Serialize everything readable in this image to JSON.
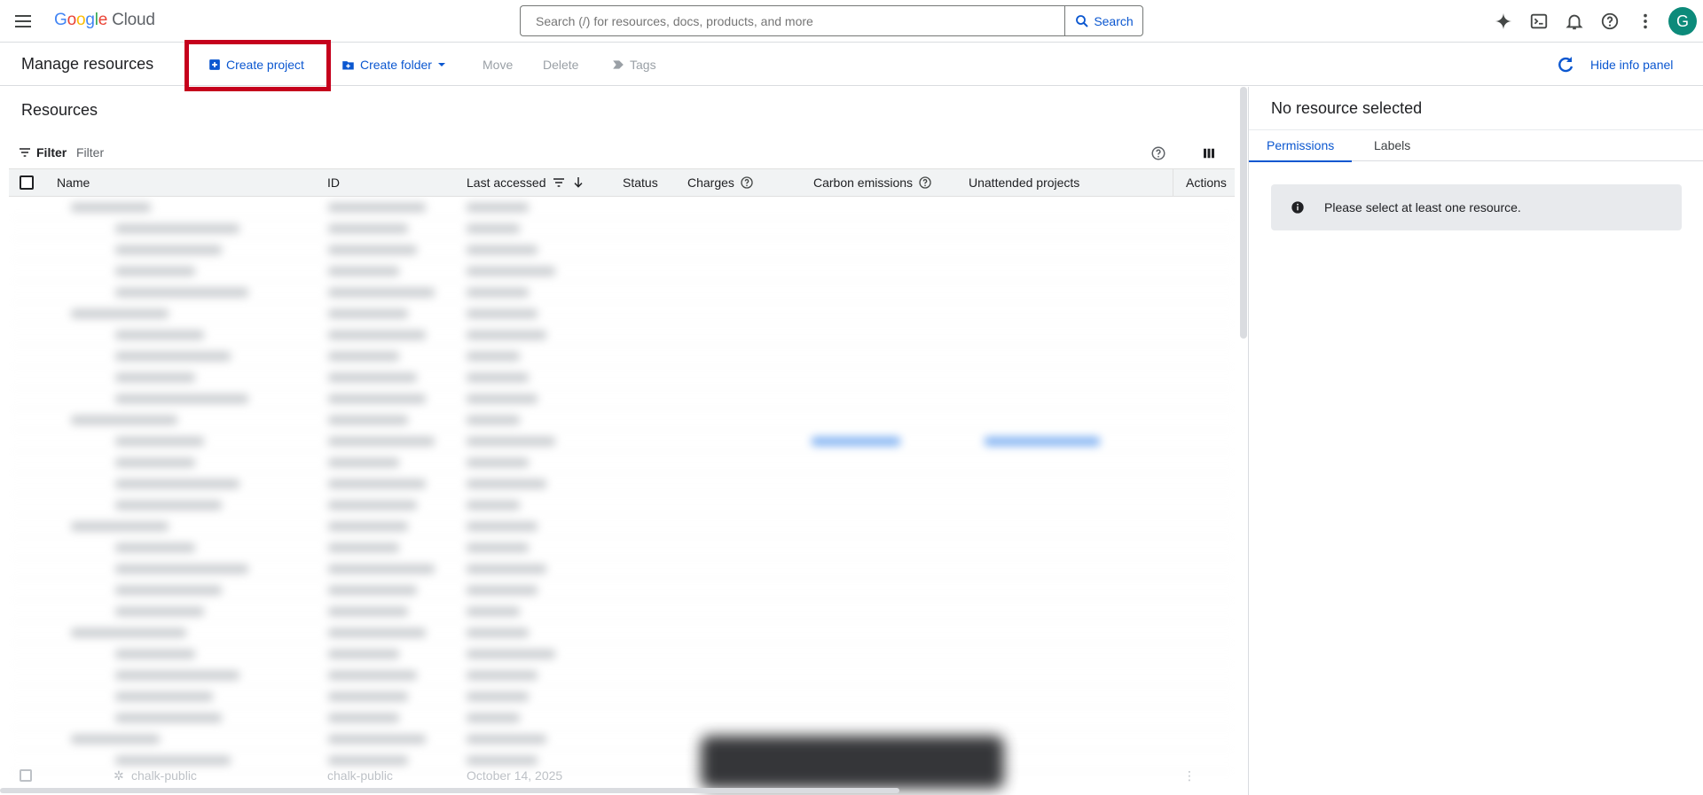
{
  "topbar": {
    "logo_parts": [
      "G",
      "o",
      "o",
      "g",
      "l",
      "e"
    ],
    "logo_suffix": "Cloud",
    "search_placeholder": "Search (/) for resources, docs, products, and more",
    "search_button": "Search",
    "avatar_letter": "G"
  },
  "actionbar": {
    "title": "Manage resources",
    "create_project": "Create project",
    "create_folder": "Create folder",
    "move": "Move",
    "delete": "Delete",
    "tags": "Tags",
    "hide_info_panel": "Hide info panel"
  },
  "resources": {
    "title": "Resources",
    "filter_label": "Filter",
    "filter_placeholder": "Filter",
    "columns": [
      "Name",
      "ID",
      "Last accessed",
      "Status",
      "Charges",
      "Carbon emissions",
      "Unattended projects",
      "Actions"
    ],
    "last_row": {
      "name": "chalk-public",
      "id": "chalk-public",
      "last_accessed": "October 14, 2025"
    }
  },
  "info_panel": {
    "title": "No resource selected",
    "tabs": [
      "Permissions",
      "Labels"
    ],
    "active_tab": "Permissions",
    "message": "Please select at least one resource."
  },
  "colors": {
    "accent": "#0b57d0",
    "highlight": "#c5001c",
    "avatar_bg": "#0c8a7a"
  }
}
